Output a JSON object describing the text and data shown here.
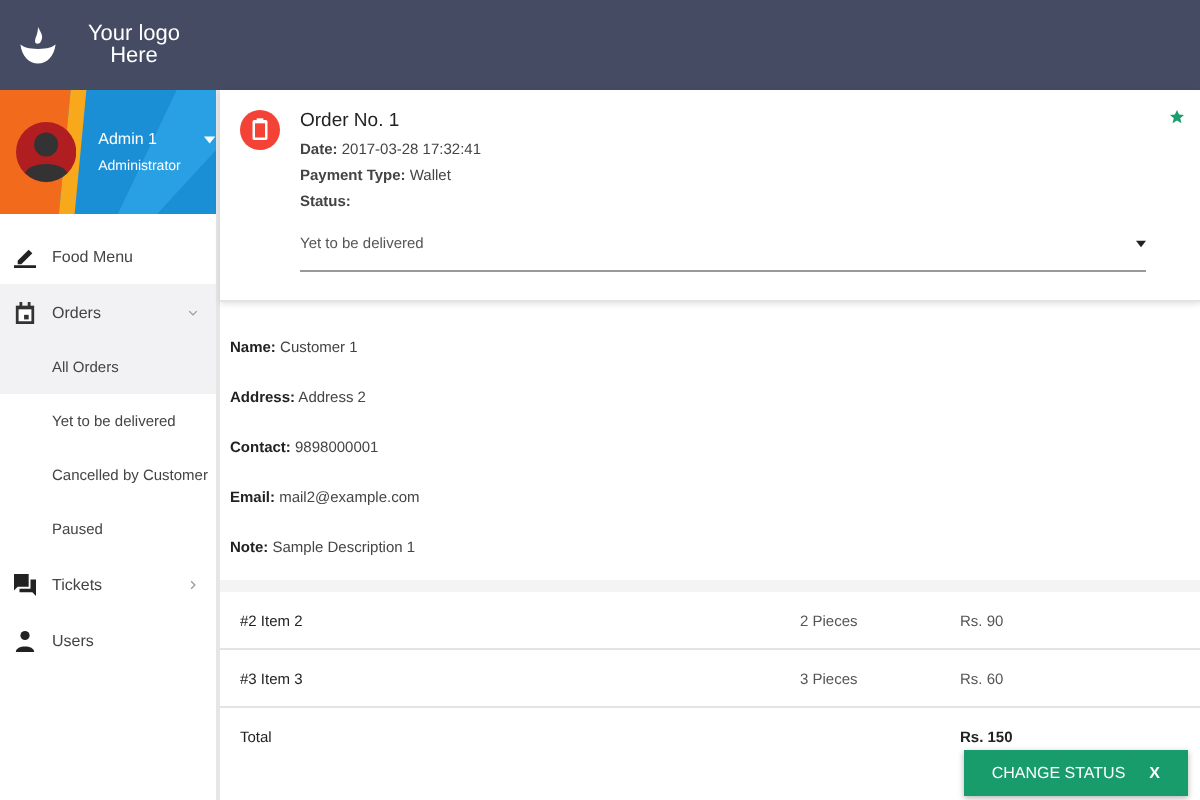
{
  "header": {
    "logo_text": "Your logo Here"
  },
  "profile": {
    "name": "Admin 1",
    "role": "Administrator"
  },
  "menu": [
    {
      "label": "Food Menu",
      "selected": false
    },
    {
      "label": "Orders",
      "selected": true,
      "expanded": true,
      "children": [
        {
          "label": "All Orders",
          "selected": true
        },
        {
          "label": "Yet to be delivered",
          "selected": false
        },
        {
          "label": "Cancelled by Customer",
          "selected": false
        },
        {
          "label": "Paused",
          "selected": false
        }
      ]
    },
    {
      "label": "Tickets",
      "selected": false,
      "expanded": false
    },
    {
      "label": "Users",
      "selected": false
    }
  ],
  "order": {
    "title": "Order No. 1",
    "lines": [
      "**Date:** 2017-03-28 17:32:41",
      "**Payment Type:** Wallet"
    ],
    "status_label": "Status:",
    "status_value": "Yet to be delivered"
  },
  "details": [
    "**Name:** Customer 1",
    "**Address:** Address 2",
    "**Contact:** 9898000001",
    "**Email:** mail2@example.com",
    "**Note:** Sample Description 1"
  ],
  "items": [
    {
      "name": "#2 Item 2",
      "qty": "2 Pieces",
      "price": "Rs. 90"
    },
    {
      "name": "#3 Item 3",
      "qty": "3 Pieces",
      "price": "Rs. 60"
    }
  ],
  "total": {
    "label": "Total",
    "price": "Rs. 150"
  },
  "action_button": {
    "label": "CHANGE STATUS",
    "close": "X"
  }
}
